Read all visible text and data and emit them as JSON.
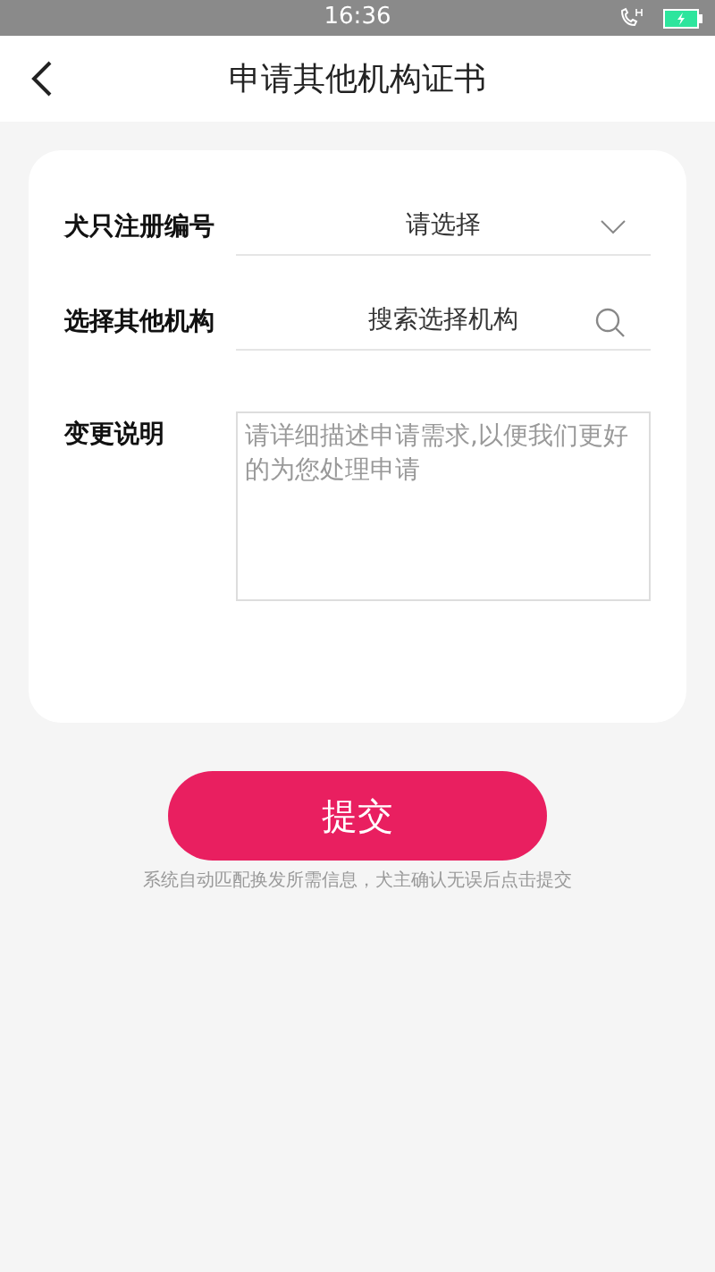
{
  "status_bar": {
    "time": "16:36"
  },
  "header": {
    "title": "申请其他机构证书"
  },
  "fields": [
    {
      "kind": "select",
      "label": "犬只注册编号",
      "placeholder": "请选择"
    },
    {
      "kind": "search",
      "label": "选择其他机构",
      "placeholder": "搜索选择机构"
    },
    {
      "kind": "textarea",
      "label": "变更说明",
      "placeholder": "请详细描述申请需求,以便我们更好的为您处理申请"
    }
  ],
  "submit": {
    "label": "提交"
  },
  "note": "系统自动匹配换发所需信息，犬主确认无误后点击提交"
}
